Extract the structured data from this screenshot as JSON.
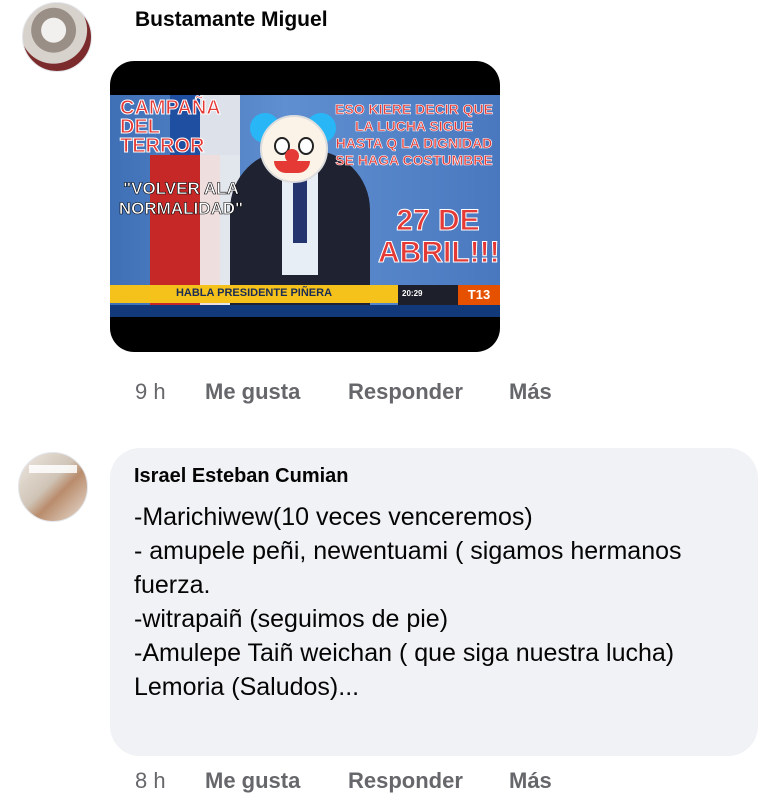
{
  "comment1": {
    "author": "Bustamante Miguel",
    "avatar_icon": "profile-photo",
    "image": {
      "campaign_text": "CAMPAÑA DEL TERROR",
      "quote_text": "\"VOLVER ALA NORMALIDAD\"",
      "slogan_text": "ESO KIERE DECIR QUE LA LUCHA SIGUE HASTA Q LA DIGNIDAD SE HAGA COSTUMBRE",
      "date_text": "27 DE ABRIL!!!!",
      "lower_third": "HABLA PRESIDENTE PIÑERA",
      "clock": "20:29",
      "channel_logo": "T13"
    },
    "actions": {
      "time": "9 h",
      "like": "Me gusta",
      "reply": "Responder",
      "more": "Más"
    }
  },
  "comment2": {
    "author": "Israel Esteban Cumian",
    "avatar_icon": "profile-photo",
    "text": "-Marichiwew(10 veces venceremos)\n- amupele peñi, newentuami ( sigamos hermanos fuerza.\n-witrapaiñ (seguimos de pie)\n-Amulepe Taiñ weichan ( que siga nuestra lucha)\nLemoria (Saludos)...",
    "actions": {
      "time": "8 h",
      "like": "Me gusta",
      "reply": "Responder",
      "more": "Más"
    }
  },
  "colors": {
    "meta_text": "#65676b",
    "bubble_bg": "#f0f2f5",
    "name_text": "#050505"
  }
}
